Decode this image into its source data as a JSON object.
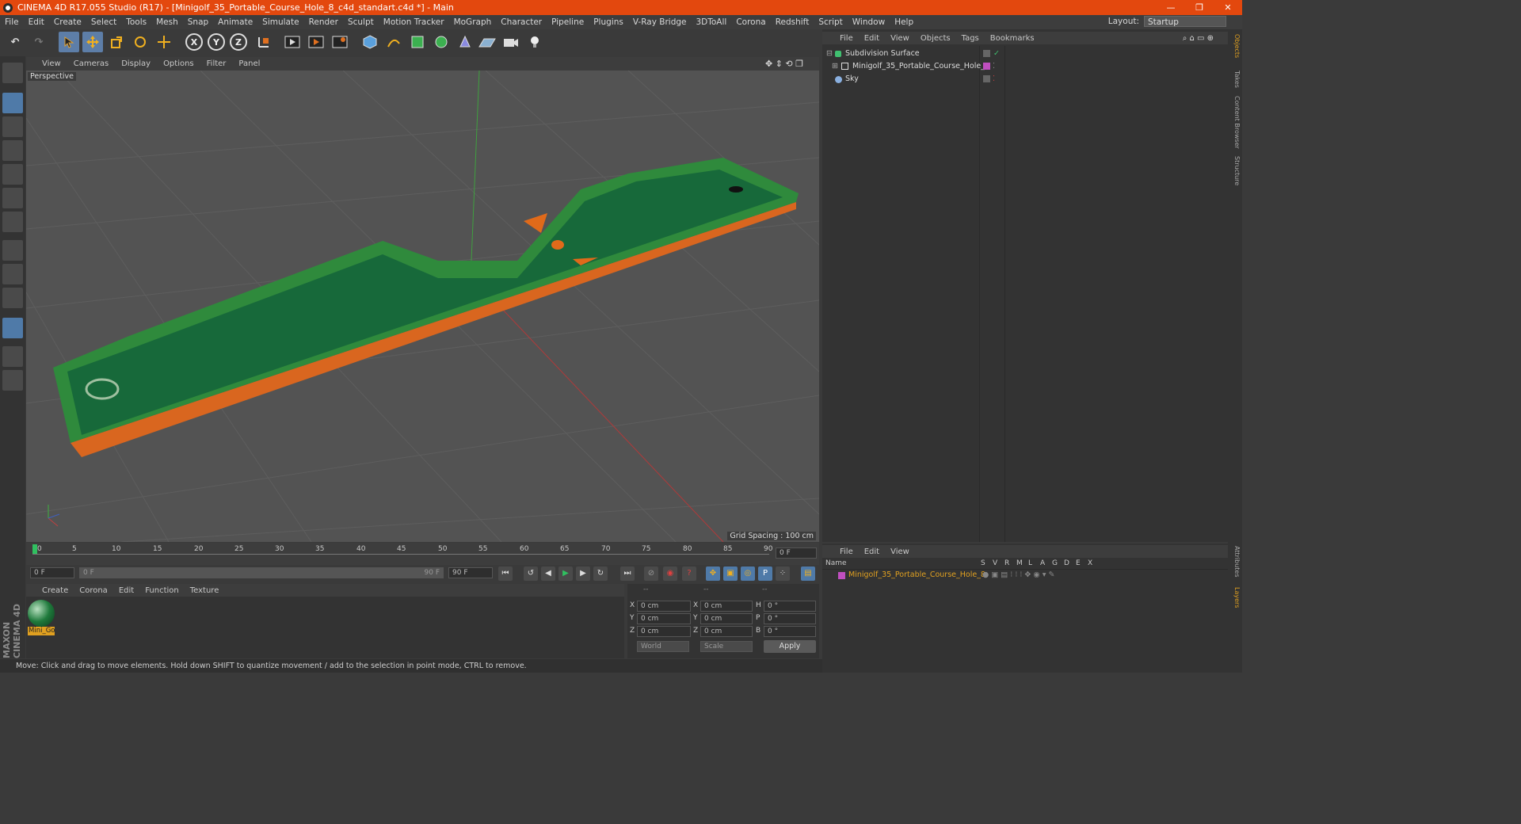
{
  "window": {
    "title": "CINEMA 4D R17.055 Studio (R17) - [Minigolf_35_Portable_Course_Hole_8_c4d_standart.c4d *] - Main",
    "minimize": "—",
    "maximize": "❐",
    "close": "✕"
  },
  "menubar": {
    "items": [
      "File",
      "Edit",
      "Create",
      "Select",
      "Tools",
      "Mesh",
      "Snap",
      "Animate",
      "Simulate",
      "Render",
      "Sculpt",
      "Motion Tracker",
      "MoGraph",
      "Character",
      "Pipeline",
      "Plugins",
      "V-Ray Bridge",
      "3DToAll",
      "Corona",
      "Redshift",
      "Script",
      "Window",
      "Help"
    ],
    "layout_label": "Layout:",
    "layout_value": "Startup"
  },
  "toolbar": {
    "axis_x": "X",
    "axis_y": "Y",
    "axis_z": "Z"
  },
  "viewport": {
    "menu": [
      "View",
      "Cameras",
      "Display",
      "Options",
      "Filter",
      "Panel"
    ],
    "label": "Perspective",
    "grid_spacing": "Grid Spacing : 100 cm"
  },
  "timeline": {
    "ticks": [
      "0",
      "5",
      "10",
      "15",
      "20",
      "25",
      "30",
      "35",
      "40",
      "45",
      "50",
      "55",
      "60",
      "65",
      "70",
      "75",
      "80",
      "85",
      "90"
    ],
    "current_frame": "0 F"
  },
  "transport": {
    "start_field": "0 F",
    "range_start": "0 F",
    "range_end": "90 F",
    "end_field": "90 F"
  },
  "material_manager": {
    "menu": [
      "Create",
      "Corona",
      "Edit",
      "Function",
      "Texture"
    ],
    "material_name": "Mini_Go"
  },
  "coordinates": {
    "headers": [
      "--",
      "--",
      "--"
    ],
    "rows": [
      {
        "a": "X",
        "v1": "0 cm",
        "b": "X",
        "v2": "0 cm",
        "c": "H",
        "v3": "0 °"
      },
      {
        "a": "Y",
        "v1": "0 cm",
        "b": "Y",
        "v2": "0 cm",
        "c": "P",
        "v3": "0 °"
      },
      {
        "a": "Z",
        "v1": "0 cm",
        "b": "Z",
        "v2": "0 cm",
        "c": "B",
        "v3": "0 °"
      }
    ],
    "mode": "World",
    "scale": "Scale",
    "apply": "Apply"
  },
  "object_manager": {
    "menu": [
      "File",
      "Edit",
      "View",
      "Objects",
      "Tags",
      "Bookmarks"
    ],
    "objects": [
      "Subdivision Surface",
      "Minigolf_35_Portable_Course_Hole_8",
      "Sky"
    ]
  },
  "layer_manager": {
    "menu": [
      "File",
      "Edit",
      "View"
    ],
    "name_header": "Name",
    "columns": [
      "S",
      "V",
      "R",
      "M",
      "L",
      "A",
      "G",
      "D",
      "E",
      "X"
    ],
    "layer_name": "Minigolf_35_Portable_Course_Hole_8"
  },
  "right_tabs": [
    "Objects",
    "Takes",
    "Content Browser",
    "Structure"
  ],
  "right_tabs_lower": [
    "Attributes",
    "Layers"
  ],
  "brand": "MAXON CINEMA 4D",
  "status": "Move: Click and drag to move elements. Hold down SHIFT to quantize movement / add to the selection in point mode, CTRL to remove.",
  "colors": {
    "accent": "#e3480e",
    "course_green": "#1f7a3c",
    "course_orange": "#d9661f",
    "layer_color": "#c04fc0"
  }
}
